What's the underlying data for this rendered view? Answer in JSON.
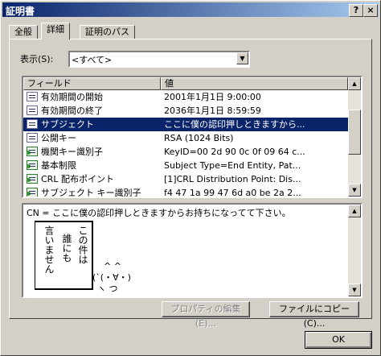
{
  "window": {
    "title": "証明書",
    "help_btn": "?",
    "close_btn": "×"
  },
  "tabs": [
    {
      "label": "全般"
    },
    {
      "label": "詳細"
    },
    {
      "label": "証明のパス"
    }
  ],
  "show": {
    "label": "表示(S):",
    "value": "<すべて>"
  },
  "list": {
    "columns": [
      "フィールド",
      "値"
    ],
    "rows": [
      {
        "field": "有効期間の開始",
        "value": "2001年1月1日 9:00:00",
        "icon": "field-icon"
      },
      {
        "field": "有効期間の終了",
        "value": "2036年1月1日 8:59:59",
        "icon": "field-icon"
      },
      {
        "field": "サブジェクト",
        "value": "ここに僕の認印押しときますから...",
        "icon": "field-icon"
      },
      {
        "field": "公開キー",
        "value": "RSA (1024 Bits)",
        "icon": "field-icon"
      },
      {
        "field": "機関キー識別子",
        "value": "KeyID=00 2d 90 0c 0f 09 64 c...",
        "icon": "extension-icon"
      },
      {
        "field": "基本制限",
        "value": "Subject Type=End Entity, Pat...",
        "icon": "extension-icon"
      },
      {
        "field": "CRL 配布ポイント",
        "value": "[1]CRL Distribution Point: Dis...",
        "icon": "extension-icon"
      },
      {
        "field": "サブジェクト キー識別子",
        "value": "f4 47 1a 99 47 6d a0 be 2a 2...",
        "icon": "extension-icon"
      }
    ]
  },
  "detail": {
    "line": "CN = ここに僕の認印押しときますからお持ちになってて下さい。",
    "art_col1": "この件は",
    "art_col2": "誰にも",
    "art_col3": "言いません",
    "art_ears": "^  ^",
    "art_face": "(`(・∀・)",
    "art_feet": "ヽ   つ"
  },
  "buttons": {
    "properties": "プロパティの編集(E)...",
    "copy": "ファイルにコピー(C)...",
    "ok": "OK"
  }
}
